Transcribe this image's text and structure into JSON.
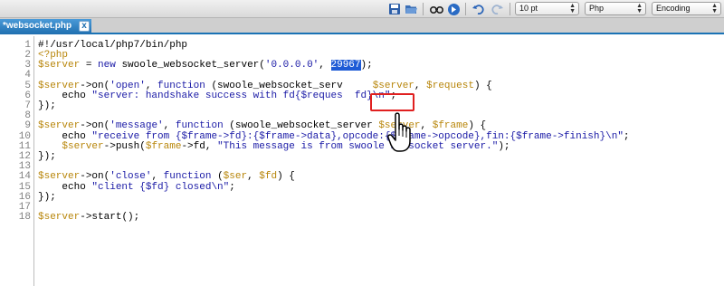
{
  "toolbar": {
    "font_size": "10 pt",
    "language": "Php",
    "encoding": "Encoding",
    "icons": [
      "save-icon",
      "open-icon",
      "find-icon",
      "goto-icon",
      "undo-icon",
      "redo-icon"
    ]
  },
  "tab": {
    "title": "*websocket.php",
    "close_label": "x"
  },
  "colors": {
    "variable": "#b8860b",
    "keyword": "#1a1aa6",
    "selection": "#1e5bd6",
    "highlight_box": "#e02020",
    "tab": "#1f6fb0"
  },
  "editor": {
    "lines": [
      {
        "n": "1",
        "t": [
          [
            "#!/usr/local/php7/bin/php",
            "plain"
          ]
        ]
      },
      {
        "n": "2",
        "t": [
          [
            "<?php",
            "var"
          ]
        ]
      },
      {
        "n": "3",
        "t": [
          [
            "$server",
            "var"
          ],
          [
            " = ",
            "plain"
          ],
          [
            "new",
            "kw"
          ],
          [
            " swoole_websocket_server(",
            "plain"
          ],
          [
            "'0.0.0.0'",
            "str"
          ],
          [
            ", ",
            "plain"
          ],
          [
            "29967",
            "sel"
          ],
          [
            ");",
            "plain"
          ]
        ]
      },
      {
        "n": "4",
        "t": []
      },
      {
        "n": "5",
        "t": [
          [
            "$server",
            "var"
          ],
          [
            "->",
            "plain"
          ],
          [
            "on(",
            "plain"
          ],
          [
            "'open'",
            "str"
          ],
          [
            ", ",
            "plain"
          ],
          [
            "function",
            "kw"
          ],
          [
            " (swoole_websocket_serv",
            "plain"
          ],
          [
            "     ",
            "plain"
          ],
          [
            "$server",
            "var"
          ],
          [
            ", ",
            "plain"
          ],
          [
            "$request",
            "var"
          ],
          [
            ") {",
            "plain"
          ]
        ]
      },
      {
        "n": "6",
        "t": [
          [
            "    echo ",
            "plain"
          ],
          [
            "\"server: handshake success with fd{$reques",
            "str"
          ],
          [
            "  ",
            "plain"
          ],
          [
            "fd}\\n\"",
            "str"
          ],
          [
            ";",
            "plain"
          ]
        ]
      },
      {
        "n": "7",
        "t": [
          [
            "});",
            "plain"
          ]
        ]
      },
      {
        "n": "8",
        "t": []
      },
      {
        "n": "9",
        "t": [
          [
            "$server",
            "var"
          ],
          [
            "->",
            "plain"
          ],
          [
            "on(",
            "plain"
          ],
          [
            "'message'",
            "str"
          ],
          [
            ", ",
            "plain"
          ],
          [
            "function",
            "kw"
          ],
          [
            " (swoole_websocket_server ",
            "plain"
          ],
          [
            "$server",
            "var"
          ],
          [
            ", ",
            "plain"
          ],
          [
            "$frame",
            "var"
          ],
          [
            ") {",
            "plain"
          ]
        ]
      },
      {
        "n": "10",
        "t": [
          [
            "    echo ",
            "plain"
          ],
          [
            "\"receive from {$frame->fd}:{$frame->data},opcode:{$frame->opcode},fin:{$frame->finish}\\n\"",
            "str"
          ],
          [
            ";",
            "plain"
          ]
        ]
      },
      {
        "n": "11",
        "t": [
          [
            "    ",
            "plain"
          ],
          [
            "$server",
            "var"
          ],
          [
            "->push(",
            "plain"
          ],
          [
            "$frame",
            "var"
          ],
          [
            "->fd, ",
            "plain"
          ],
          [
            "\"This message is from swoole websocket server.\"",
            "str"
          ],
          [
            ");",
            "plain"
          ]
        ]
      },
      {
        "n": "12",
        "t": [
          [
            "});",
            "plain"
          ]
        ]
      },
      {
        "n": "13",
        "t": []
      },
      {
        "n": "14",
        "t": [
          [
            "$server",
            "var"
          ],
          [
            "->",
            "plain"
          ],
          [
            "on(",
            "plain"
          ],
          [
            "'close'",
            "str"
          ],
          [
            ", ",
            "plain"
          ],
          [
            "function",
            "kw"
          ],
          [
            " (",
            "plain"
          ],
          [
            "$ser",
            "var"
          ],
          [
            ", ",
            "plain"
          ],
          [
            "$fd",
            "var"
          ],
          [
            ") {",
            "plain"
          ]
        ]
      },
      {
        "n": "15",
        "t": [
          [
            "    echo ",
            "plain"
          ],
          [
            "\"client {$fd} closed\\n\"",
            "str"
          ],
          [
            ";",
            "plain"
          ]
        ]
      },
      {
        "n": "16",
        "t": [
          [
            "});",
            "plain"
          ]
        ]
      },
      {
        "n": "17",
        "t": []
      },
      {
        "n": "18",
        "t": [
          [
            "$server",
            "var"
          ],
          [
            "->",
            "plain"
          ],
          [
            "start",
            "plain"
          ],
          [
            "();",
            "plain"
          ]
        ]
      }
    ]
  }
}
